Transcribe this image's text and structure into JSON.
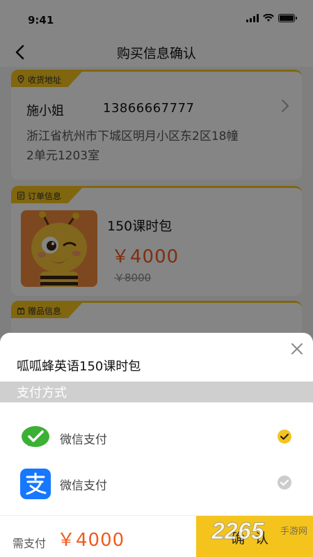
{
  "status_bar": {
    "time": "9:41"
  },
  "nav": {
    "title": "购买信息确认"
  },
  "address_card": {
    "tag": "收货地址",
    "name": "施小姐",
    "phone": "13866667777",
    "address_line1": "浙江省杭州市下城区明月小区东2区18幢",
    "address_line2": "2单元1203室"
  },
  "order_card": {
    "tag": "订单信息",
    "product_name": "150课时包",
    "price": "￥4000",
    "original_price": "￥8000"
  },
  "gift_card": {
    "tag": "赠品信息"
  },
  "sheet": {
    "title": "呱呱蜂英语150课时包",
    "payment_header": "支付方式",
    "options": [
      {
        "label": "微信支付",
        "icon": "wechat-pay-icon",
        "selected": true
      },
      {
        "label": "微信支付",
        "icon": "alipay-icon",
        "selected": false
      }
    ],
    "due_label": "需支付",
    "due_amount": "￥4000",
    "confirm_label": "确认"
  },
  "watermark": {
    "number": "2265",
    "text": "手游网"
  },
  "colors": {
    "accent": "#f5c41c",
    "price": "#f25a1c",
    "wechat": "#3cb034",
    "alipay": "#1677ff"
  }
}
